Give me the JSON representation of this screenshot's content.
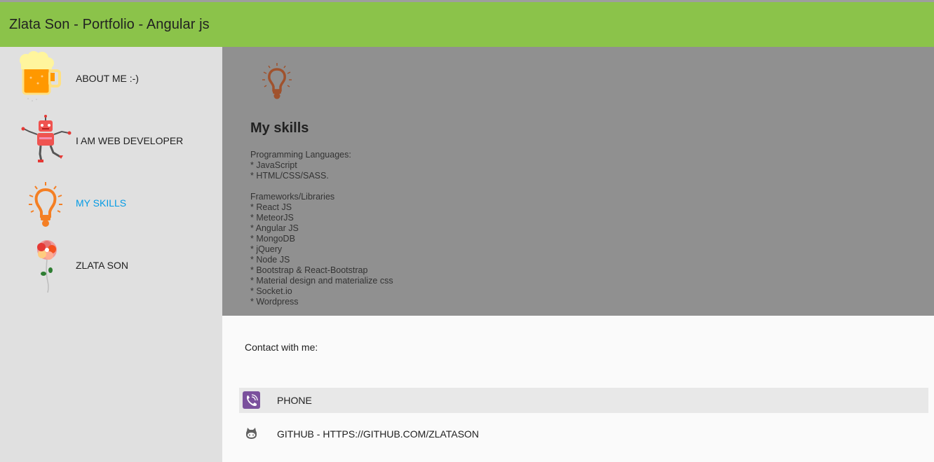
{
  "app": {
    "title": "Zlata Son - Portfolio - Angular js"
  },
  "sidebar": {
    "items": [
      {
        "label": "ABOUT ME :-)",
        "icon": "beer-mug-icon"
      },
      {
        "label": "I AM WEB DEVELOPER",
        "icon": "robot-icon"
      },
      {
        "label": "MY SKILLS",
        "icon": "lightbulb-icon",
        "active": true
      },
      {
        "label": "ZLATA SON",
        "icon": "flower-icon"
      }
    ]
  },
  "main": {
    "heading": "My skills",
    "lines": [
      "Programming Languages:",
      "* JavaScript",
      "* HTML/CSS/SASS.",
      "",
      "Frameworks/Libraries",
      "* React JS",
      "* MeteorJS",
      "* Angular JS",
      "* MongoDB",
      "* jQuery",
      "* Node JS",
      "* Bootstrap & React-Bootstrap",
      "* Material design and materialize css",
      "* Socket.io",
      "* Wordpress"
    ]
  },
  "contact": {
    "heading": "Contact with me:",
    "items": [
      {
        "label": "PHONE",
        "icon": "viber-icon"
      },
      {
        "label": "GITHUB - HTTPS://GITHUB.COM/ZLATASON",
        "icon": "github-icon"
      }
    ]
  },
  "colors": {
    "toolbar": "#8bc34a",
    "sidebar": "#e0e0e0",
    "content": "#909090",
    "active_link": "#039be5",
    "viber": "#7b519d"
  }
}
